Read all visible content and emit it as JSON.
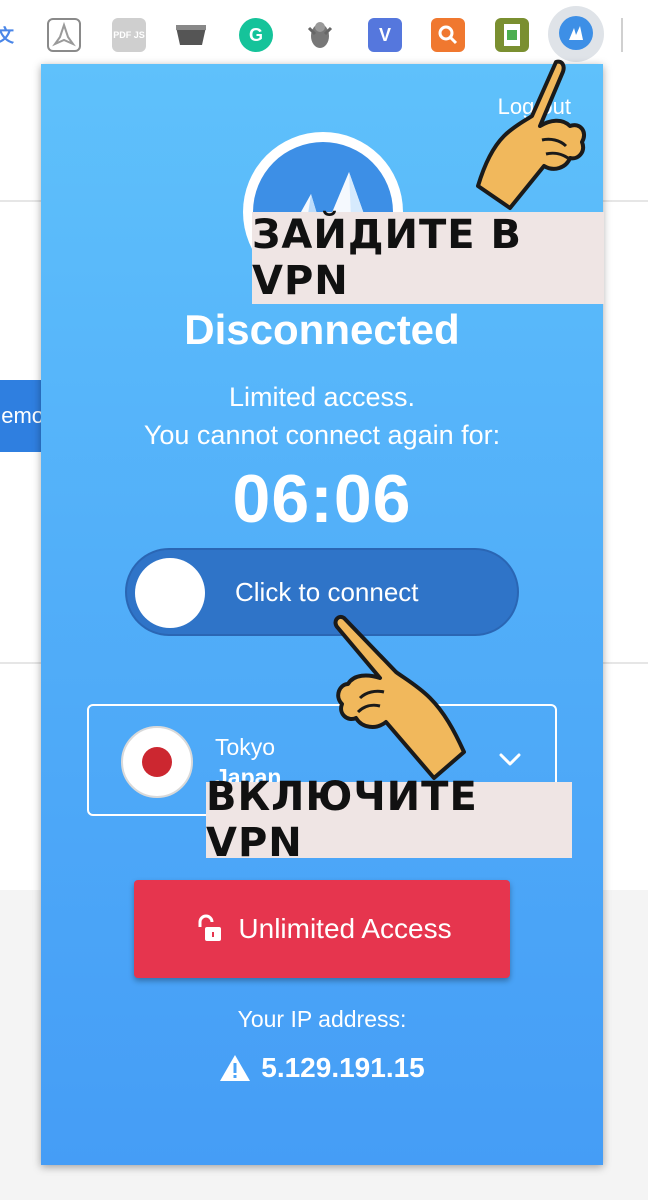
{
  "toolbar": {
    "extensions": [
      {
        "name": "translate-ext-icon",
        "glyph": "文",
        "color": "#4a86e8"
      },
      {
        "name": "acrobat-ext-icon",
        "glyph": "A",
        "color": "#8a8a8a"
      },
      {
        "name": "pdfjs-ext-icon",
        "glyph": "PDF JS",
        "color": "#b0b0b0"
      },
      {
        "name": "tray-ext-icon",
        "glyph": "",
        "color": "#555555"
      },
      {
        "name": "grammarly-ext-icon",
        "glyph": "G",
        "color": "#15c39a"
      },
      {
        "name": "bee-ext-icon",
        "glyph": "",
        "color": "#8c8c8c"
      },
      {
        "name": "v-ext-icon",
        "glyph": "V",
        "color": "#5577dd"
      },
      {
        "name": "search-ext-icon",
        "glyph": "",
        "color": "#f0782f"
      },
      {
        "name": "android-ext-icon",
        "glyph": "",
        "color": "#7a8f30"
      },
      {
        "name": "vpn-ext-icon",
        "glyph": "",
        "color": "#3d8fe6"
      }
    ]
  },
  "background": {
    "button_text": "emo"
  },
  "popup": {
    "logout_label": "Log out",
    "status": "Disconnected",
    "limited_line1": "Limited access.",
    "limited_line2": "You cannot connect again for:",
    "timer": "06:06",
    "connect_label": "Click to connect",
    "location": {
      "city": "Tokyo",
      "country": "Japan"
    },
    "unlimited_label": "Unlimited Access",
    "ip_label": "Your IP address:",
    "ip_value": "5.129.191.15"
  },
  "annotations": {
    "top": "ЗАЙДИТЕ В VPN",
    "bottom": "ВКЛЮЧИТЕ VPN"
  },
  "colors": {
    "popup_top": "#5fc1fb",
    "popup_bottom": "#459df6",
    "toggle": "#2f74c8",
    "unlimited": "#e6354e",
    "flag_red": "#cc2730"
  }
}
